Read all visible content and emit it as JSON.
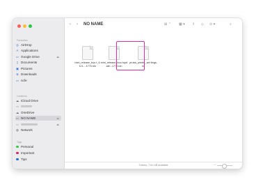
{
  "window": {
    "title": "NO NAME",
    "status_text": "3 items, 7.61 GB available"
  },
  "toolbar": {
    "back_icon": "chevron-left-icon",
    "forward_icon": "chevron-right-icon"
  },
  "sidebar": {
    "favourites_title": "Favourites",
    "locations_title": "Locations",
    "tags_title": "Tags",
    "favourites": [
      {
        "label": "AirDrop",
        "icon": "airdrop-icon"
      },
      {
        "label": "Applications",
        "icon": "applications-icon"
      },
      {
        "label": "Google Drive",
        "icon": "drive-icon"
      },
      {
        "label": "Documents",
        "icon": "document-icon"
      },
      {
        "label": "Pictures",
        "icon": "pictures-icon"
      },
      {
        "label": "Downloads",
        "icon": "downloads-icon"
      },
      {
        "label": "ncfe",
        "icon": "folder-icon"
      }
    ],
    "locations": [
      {
        "label": "iCloud Drive",
        "icon": "cloud-icon"
      },
      {
        "label": "OneDrive",
        "icon": "cloud-icon"
      },
      {
        "label": "NO NAME",
        "icon": "drive-icon"
      },
      {
        "label": "Network",
        "icon": "network-icon"
      }
    ],
    "tags": [
      {
        "label": "Personal",
        "color": "#2ecc40"
      },
      {
        "label": "Important",
        "color": "#e0245e"
      },
      {
        "label": "Tips",
        "color": "#1e6fd9"
      }
    ]
  },
  "files": [
    {
      "name": "mini_release_boo t_6.6.0-...1770.bin"
    },
    {
      "name": "mini_release_boo tupdate...1770.bin"
    },
    {
      "name": "prusa_printer_set tings.ini"
    }
  ]
}
